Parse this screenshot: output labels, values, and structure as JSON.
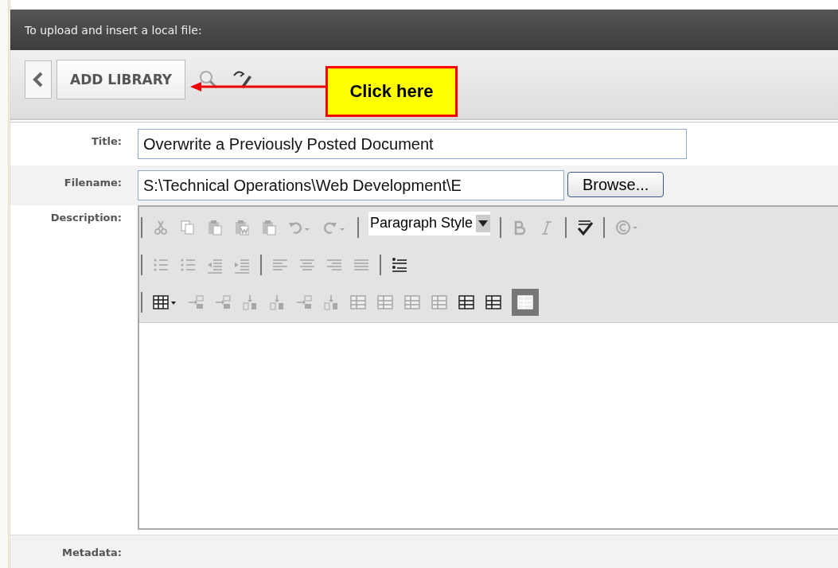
{
  "header": {
    "title": "To upload and insert a local file:"
  },
  "toolbar": {
    "back": {
      "kind": "back"
    },
    "add_button": "ADD LIBRARY",
    "tools": [
      {
        "kind": "search"
      },
      {
        "kind": "pen"
      }
    ]
  },
  "callout": {
    "label": "Click here"
  },
  "form": {
    "title": {
      "label": "Title:",
      "value": "Overwrite a Previously Posted Document"
    },
    "filename": {
      "label": "Filename:",
      "value": "S:\\Technical Operations\\Web Development\\E",
      "button": "Browse..."
    },
    "description": {
      "label": "Description:",
      "style_select": "Paragraph Style",
      "toolbar_rows": [
        [
          {
            "kind": "sep"
          },
          {
            "kind": "cut",
            "disabled": true
          },
          {
            "kind": "copy",
            "disabled": true
          },
          {
            "kind": "paste",
            "disabled": true
          },
          {
            "kind": "paste-word",
            "disabled": true
          },
          {
            "kind": "paste-text",
            "disabled": true
          },
          {
            "kind": "undo",
            "disabled": true
          },
          {
            "kind": "redo",
            "disabled": true
          },
          {
            "kind": "sep"
          },
          {
            "kind": "style"
          },
          {
            "kind": "sep"
          },
          {
            "kind": "bold",
            "disabled": true
          },
          {
            "kind": "italic",
            "disabled": true
          },
          {
            "kind": "sep"
          },
          {
            "kind": "spell",
            "disabled": false
          },
          {
            "kind": "sep"
          },
          {
            "kind": "copyright",
            "disabled": true
          }
        ],
        [
          {
            "kind": "sep"
          },
          {
            "kind": "ordered-list",
            "disabled": true
          },
          {
            "kind": "bullet-list",
            "disabled": true
          },
          {
            "kind": "outdent",
            "disabled": true
          },
          {
            "kind": "indent",
            "disabled": true
          },
          {
            "kind": "sep"
          },
          {
            "kind": "align-left",
            "disabled": true
          },
          {
            "kind": "align-center",
            "disabled": true
          },
          {
            "kind": "align-right",
            "disabled": true
          },
          {
            "kind": "justify",
            "disabled": true
          },
          {
            "kind": "sep"
          },
          {
            "kind": "line-spacing",
            "disabled": false
          }
        ],
        [
          {
            "kind": "sep"
          },
          {
            "kind": "table",
            "disabled": false,
            "selected": false
          },
          {
            "kind": "row-op",
            "disabled": true,
            "selected": false
          },
          {
            "kind": "row-op",
            "disabled": true,
            "selected": false
          },
          {
            "kind": "col-op",
            "disabled": true,
            "selected": false
          },
          {
            "kind": "col-op",
            "disabled": true,
            "selected": false
          },
          {
            "kind": "row-op",
            "disabled": true,
            "selected": false
          },
          {
            "kind": "col-op",
            "disabled": true,
            "selected": false
          },
          {
            "kind": "grid",
            "disabled": true,
            "selected": false
          },
          {
            "kind": "grid",
            "disabled": true,
            "selected": false
          },
          {
            "kind": "grid",
            "disabled": true,
            "selected": false
          },
          {
            "kind": "grid",
            "disabled": true,
            "selected": false
          },
          {
            "kind": "grid",
            "disabled": false,
            "selected": false
          },
          {
            "kind": "grid",
            "disabled": false,
            "selected": false
          },
          {
            "kind": "grid",
            "disabled": false,
            "selected": true
          }
        ]
      ]
    },
    "metadata": {
      "label": "Metadata:"
    }
  }
}
